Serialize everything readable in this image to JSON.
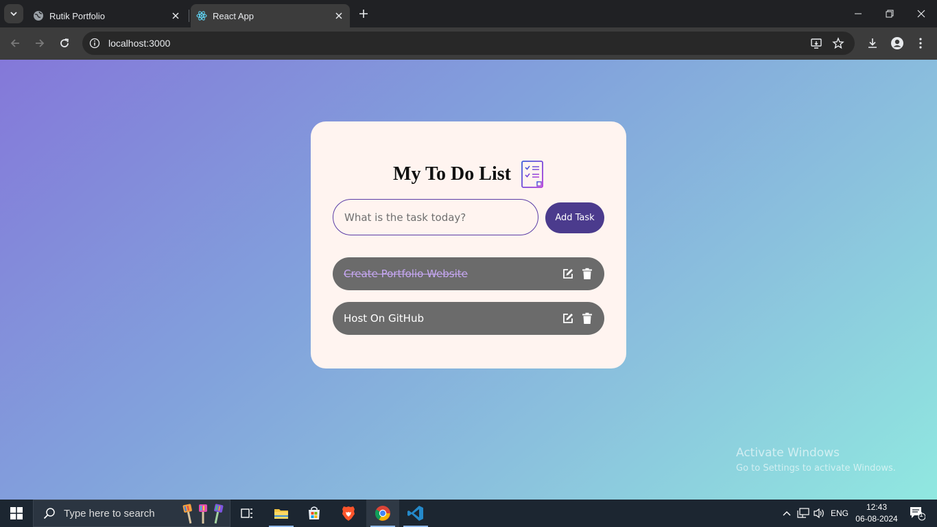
{
  "browser": {
    "tabs": [
      {
        "title": "Rutik Portfolio",
        "icon": "globe-icon",
        "active": false
      },
      {
        "title": "React App",
        "icon": "react-icon",
        "active": true
      }
    ],
    "url": "localhost:3000"
  },
  "app": {
    "title": "My To Do List",
    "input": {
      "placeholder": "What is the task today?",
      "value": ""
    },
    "add_button": "Add Task",
    "todos": [
      {
        "text": "Create Portfolio Website",
        "completed": true
      },
      {
        "text": "Host On GitHub",
        "completed": false
      }
    ]
  },
  "watermark": {
    "line1": "Activate Windows",
    "line2": "Go to Settings to activate Windows."
  },
  "taskbar": {
    "search_placeholder": "Type here to search",
    "language": "ENG",
    "time": "12:43",
    "date": "06-08-2024",
    "notification_count": "1"
  },
  "colors": {
    "card_bg": "#fff4f0",
    "accent": "#4b3b8d",
    "todo_bg": "#6b6b6b",
    "completed_text": "#c6a7f2"
  }
}
